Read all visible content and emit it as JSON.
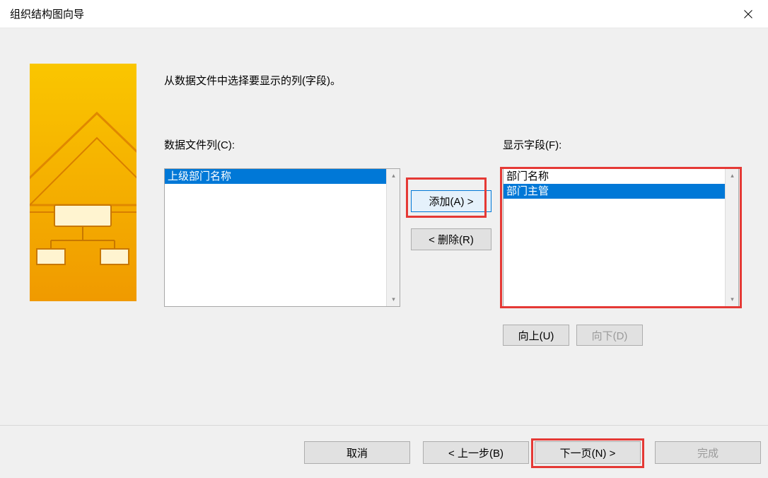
{
  "title": "组织结构图向导",
  "instruction": "从数据文件中选择要显示的列(字段)。",
  "labels": {
    "data_columns": "数据文件列(C):",
    "display_fields": "显示字段(F):"
  },
  "left_list": {
    "items": [
      {
        "label": "上级部门名称",
        "selected": true
      }
    ]
  },
  "right_list": {
    "items": [
      {
        "label": "部门名称",
        "selected": false
      },
      {
        "label": "部门主管",
        "selected": true
      }
    ]
  },
  "buttons": {
    "add": "添加(A) >",
    "remove": "< 删除(R)",
    "up": "向上(U)",
    "down": "向下(D)",
    "cancel": "取消",
    "back": "< 上一步(B)",
    "next": "下一页(N) >",
    "finish": "完成"
  }
}
